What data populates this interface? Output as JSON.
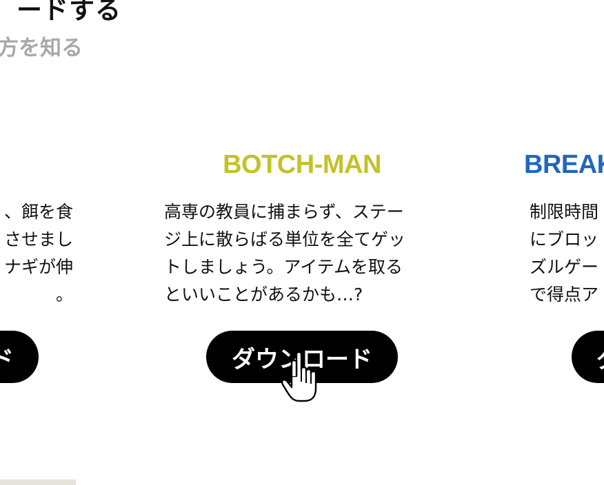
{
  "heading": {
    "title": "ードする",
    "subtitle": "方を知る"
  },
  "cards": [
    {
      "title": "",
      "title_color": "#111111",
      "description": "、餌を食\nさせまし\nナギが伸\n。",
      "button_label": "ド"
    },
    {
      "title": "BOTCH-MAN",
      "title_color": "#c2c22a",
      "description": "高専の教員に捕まらず、ステー\nジ上に散らばる単位を全てゲッ\nトしましょう。アイテムを取る\nといいことがあるかも…?",
      "button_label": "ダウンロード"
    },
    {
      "title": "BREAK",
      "title_color": "#2166c0",
      "description": "制限時間\nにブロッ\nズルゲー\nで得点ア",
      "button_label": "ダ"
    }
  ],
  "cursor": {
    "icon": "hand-pointer-icon"
  },
  "colors": {
    "button_bg": "#000000",
    "button_text": "#ffffff",
    "subtitle": "#a8a8a8"
  }
}
